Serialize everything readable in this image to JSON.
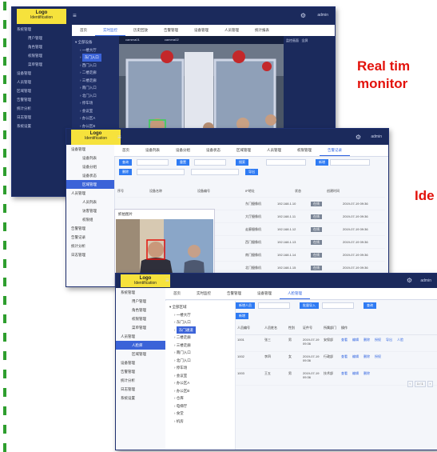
{
  "labels": {
    "realtime": "Real tim",
    "monitoring": "monitor",
    "identify": "Ide"
  },
  "colors": {
    "label_red": "#e3120b",
    "dash_green": "#2e9e2e",
    "nav_dark": "#1b2a5c",
    "accent_blue": "#2f63e0"
  },
  "logo": {
    "line1": "Logo",
    "line2": "Identification"
  },
  "shot1": {
    "user": "admin",
    "sidebar": [
      "系统管理",
      "用户管理",
      "角色管理",
      "权限管理",
      "菜单管理",
      "设备管理",
      "人员管理",
      "区域管理",
      "告警管理",
      "统计分析",
      "日志管理",
      "系统设置"
    ],
    "tabs": [
      "首页",
      "实时监控",
      "历史回放",
      "告警管理",
      "设备管理",
      "人员管理",
      "统计报表"
    ],
    "tree": [
      "全部设备",
      "一楼大厅",
      "东门入口",
      "西门入口",
      "二楼走廊",
      "三楼走廊",
      "南门入口",
      "北门入口",
      "停车场",
      "会议室",
      "办公区A",
      "办公区B",
      "仓库",
      "电梯厅"
    ],
    "video_title_a": "camera01",
    "video_title_b": "camera02",
    "right_header": "监控画面",
    "right_action": "全屏"
  },
  "shot2": {
    "user": "admin",
    "sidebar": [
      "设备管理",
      "设备列表",
      "设备分组",
      "设备状态",
      "区域管理",
      "人员管理",
      "人员列表",
      "访客管理",
      "权限组",
      "告警管理",
      "告警记录",
      "统计分析",
      "日志管理"
    ],
    "tabs": [
      "首页",
      "设备列表",
      "设备分组",
      "设备状态",
      "区域管理",
      "人员管理",
      "权限管理",
      "告警记录"
    ],
    "filters": {
      "q1": "查询",
      "q2": "重置",
      "search": "搜索",
      "add": "新增",
      "del": "删除",
      "export": "导出"
    },
    "columns": [
      "序号",
      "设备名称",
      "设备编号",
      "IP地址",
      "状态",
      "创建时间"
    ],
    "rows": [
      {
        "name": "东门摄像机",
        "ip": "192.168.1.10",
        "status": "在线",
        "time": "2019-07-19 09:36"
      },
      {
        "name": "大厅摄像机",
        "ip": "192.168.1.11",
        "status": "在线",
        "time": "2019-07-19 09:36"
      },
      {
        "name": "走廊摄像机",
        "ip": "192.168.1.12",
        "status": "在线",
        "time": "2019-07-19 09:36"
      },
      {
        "name": "西门摄像机",
        "ip": "192.168.1.13",
        "status": "在线",
        "time": "2019-07-19 09:36"
      },
      {
        "name": "南门摄像机",
        "ip": "192.168.1.14",
        "status": "在线",
        "time": "2019-07-19 09:36"
      },
      {
        "name": "北门摄像机",
        "ip": "192.168.1.15",
        "status": "在线",
        "time": "2019-07-19 09:36"
      }
    ],
    "popup_title": "抓拍图片"
  },
  "shot3": {
    "user": "admin",
    "sidebar": [
      "系统管理",
      "用户管理",
      "角色管理",
      "权限管理",
      "菜单管理",
      "人员管理",
      "人脸库",
      "区域管理",
      "设备管理",
      "告警管理",
      "统计分析",
      "日志管理",
      "系统设置"
    ],
    "tabs": [
      "首页",
      "实时监控",
      "告警管理",
      "设备管理",
      "人脸管理"
    ],
    "tree": [
      "全部区域",
      "一楼大厅",
      "东门入口",
      "东门通道",
      "二楼走廊",
      "三楼走廊",
      "南门入口",
      "北门入口",
      "停车场",
      "会议室",
      "办公区A",
      "办公区B",
      "仓库",
      "电梯厅",
      "食堂",
      "机房"
    ],
    "buttons": {
      "add": "新增人员",
      "import": "批量导入",
      "search": "查询",
      "new": "新增"
    },
    "columns": [
      "人员编号",
      "人员姓名",
      "性别",
      "证件号",
      "所属部门",
      "操作"
    ],
    "rows": [
      {
        "id": "1001",
        "name": "张三",
        "sex": "男",
        "date": "2019-07-19 09:36",
        "dept": "安保部"
      },
      {
        "id": "1002",
        "name": "李四",
        "sex": "女",
        "date": "2019-07-19 09:36",
        "dept": "行政部"
      },
      {
        "id": "1003",
        "name": "王五",
        "sex": "男",
        "date": "2019-07-19 09:36",
        "dept": "技术部"
      }
    ],
    "actions": [
      "查看",
      "编辑",
      "删除",
      "授权",
      "导出",
      "人脸"
    ],
    "pager": "1 / 1"
  }
}
